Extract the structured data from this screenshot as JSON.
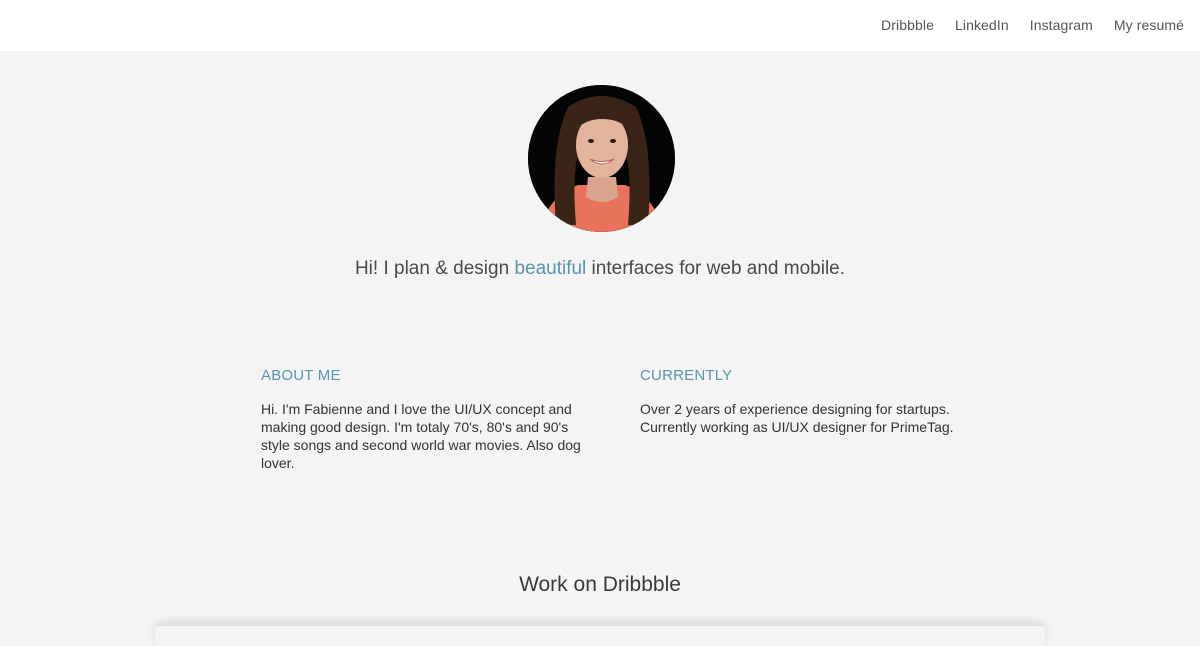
{
  "nav": {
    "items": [
      {
        "label": "Dribbble"
      },
      {
        "label": "LinkedIn"
      },
      {
        "label": "Instagram"
      },
      {
        "label": "My resumé"
      }
    ]
  },
  "hero": {
    "avatar_alt": "profile photo",
    "tagline_before": "Hi! I plan & design ",
    "tagline_accent": "beautiful",
    "tagline_after": " interfaces for web and mobile."
  },
  "about": {
    "heading": "ABOUT ME",
    "text": "Hi. I'm Fabienne and I love the UI/UX concept and making good design. I'm totaly 70's, 80's and 90's style songs and second world war movies. Also dog lover."
  },
  "currently": {
    "heading": "CURRENTLY",
    "text": "Over 2 years of experience designing for startups. Currently working as UI/UX designer for PrimeTag."
  },
  "work": {
    "title": "Work on Dribbble"
  },
  "colors": {
    "accent": "#5a94ad",
    "background": "#f4f4f4",
    "topbar": "#ffffff"
  }
}
